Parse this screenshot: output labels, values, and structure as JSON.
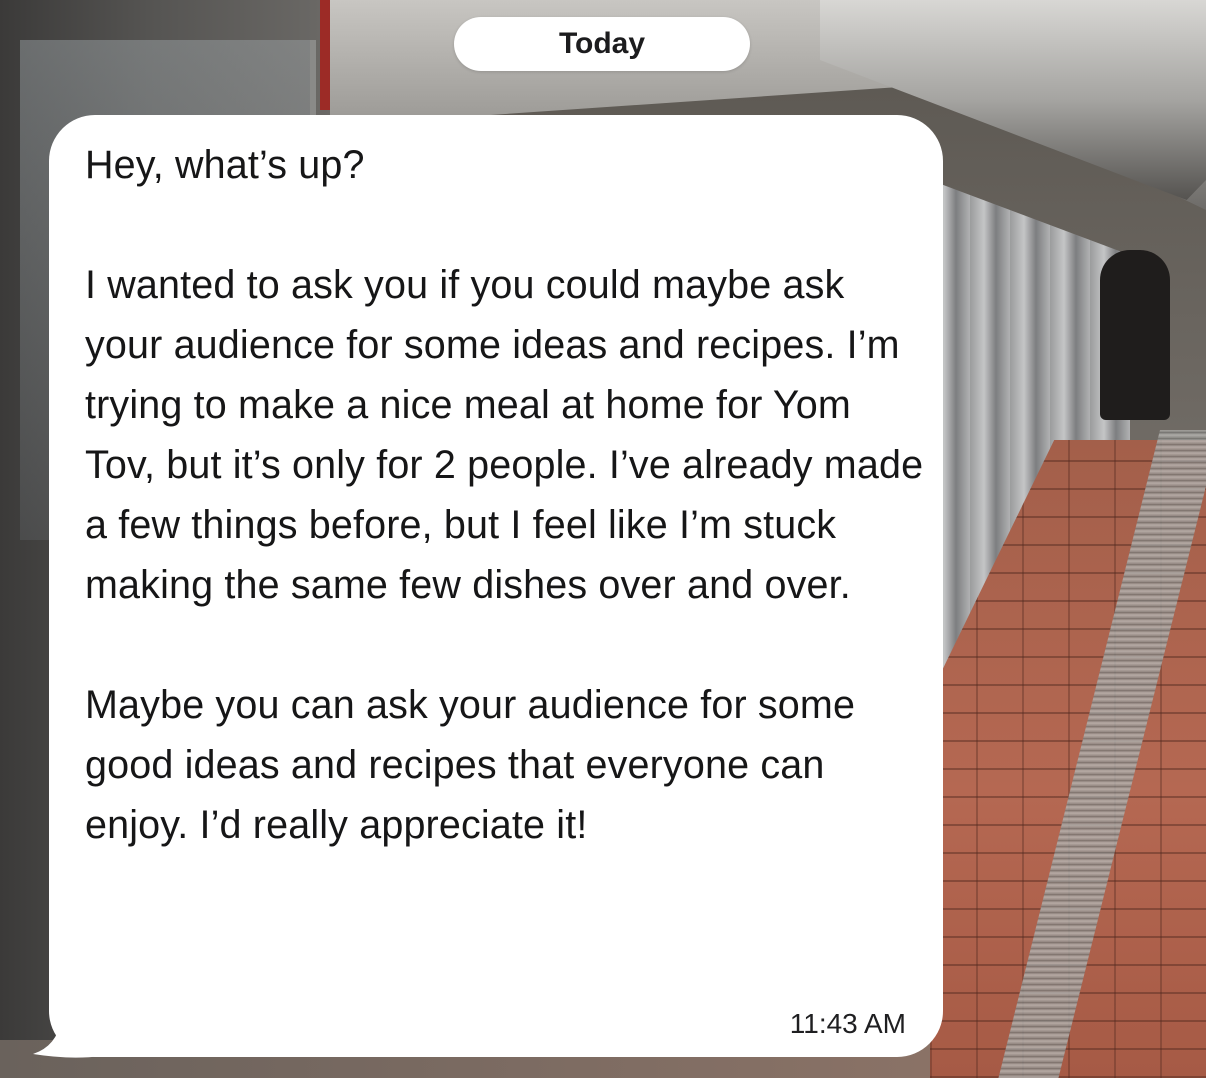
{
  "conversation": {
    "date_label": "Today",
    "message": {
      "paragraphs": [
        "Hey, what’s up?",
        "I wanted to ask you if you could maybe ask your audience for some ideas and recipes. I’m trying to make a nice meal at home for Yom Tov, but it’s only for 2 people. I’ve already made a few things before, but I feel like I’m stuck making the same few dishes over and over.",
        "Maybe you can ask your audience for some good ideas and recipes that everyone can enjoy. I’d really appreciate it!"
      ],
      "timestamp": "11:43 AM",
      "direction": "incoming",
      "bubble_color": "#ffffff",
      "text_color": "#161617"
    }
  }
}
